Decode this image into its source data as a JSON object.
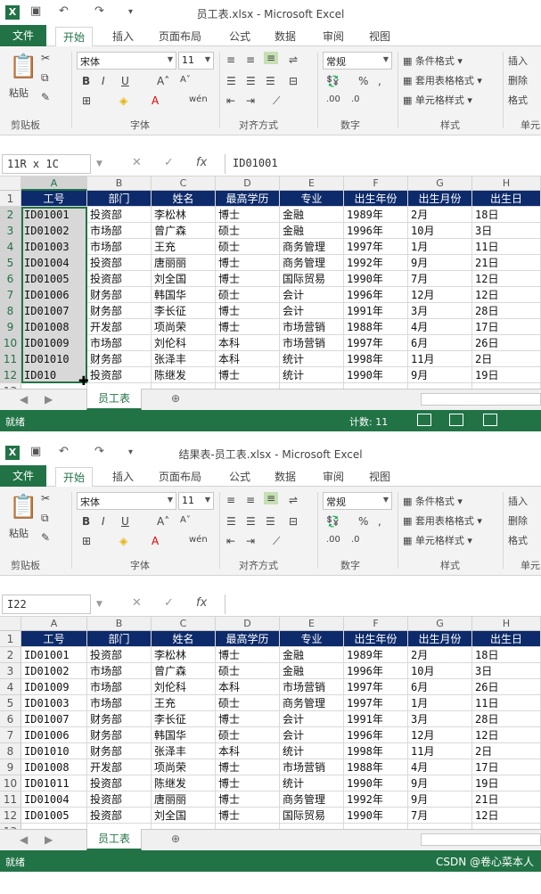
{
  "window1": {
    "title": "员工表.xlsx - Microsoft Excel",
    "namebox": "11R x 1C",
    "formula": "ID01001",
    "status": "就绪",
    "count": "计数: 11",
    "table": [
      [
        "工号",
        "部门",
        "姓名",
        "最高学历",
        "专业",
        "出生年份",
        "出生月份",
        "出生日"
      ],
      [
        "ID01001",
        "投资部",
        "李松林",
        "博士",
        "金融",
        "1989年",
        "2月",
        "18日"
      ],
      [
        "ID01002",
        "市场部",
        "曾广森",
        "硕士",
        "金融",
        "1996年",
        "10月",
        "3日"
      ],
      [
        "ID01003",
        "市场部",
        "王充",
        "硕士",
        "商务管理",
        "1997年",
        "1月",
        "11日"
      ],
      [
        "ID01004",
        "投资部",
        "唐丽丽",
        "博士",
        "商务管理",
        "1992年",
        "9月",
        "21日"
      ],
      [
        "ID01005",
        "投资部",
        "刘全国",
        "博士",
        "国际贸易",
        "1990年",
        "7月",
        "12日"
      ],
      [
        "ID01006",
        "财务部",
        "韩国华",
        "硕士",
        "会计",
        "1996年",
        "12月",
        "12日"
      ],
      [
        "ID01007",
        "财务部",
        "李长征",
        "博士",
        "会计",
        "1991年",
        "3月",
        "28日"
      ],
      [
        "ID01008",
        "开发部",
        "项尚荣",
        "博士",
        "市场营销",
        "1988年",
        "4月",
        "17日"
      ],
      [
        "ID01009",
        "市场部",
        "刘伦科",
        "本科",
        "市场营销",
        "1997年",
        "6月",
        "26日"
      ],
      [
        "ID01010",
        "财务部",
        "张泽丰",
        "本科",
        "统计",
        "1998年",
        "11月",
        "2日"
      ],
      [
        "ID010",
        "投资部",
        "陈继发",
        "博士",
        "统计",
        "1990年",
        "9月",
        "19日"
      ]
    ]
  },
  "window2": {
    "title": "结果表-员工表.xlsx - Microsoft Excel",
    "namebox": "I22",
    "formula": "",
    "status": "就绪",
    "table": [
      [
        "工号",
        "部门",
        "姓名",
        "最高学历",
        "专业",
        "出生年份",
        "出生月份",
        "出生日"
      ],
      [
        "ID01001",
        "投资部",
        "李松林",
        "博士",
        "金融",
        "1989年",
        "2月",
        "18日"
      ],
      [
        "ID01002",
        "市场部",
        "曾广森",
        "硕士",
        "金融",
        "1996年",
        "10月",
        "3日"
      ],
      [
        "ID01009",
        "市场部",
        "刘伦科",
        "本科",
        "市场营销",
        "1997年",
        "6月",
        "26日"
      ],
      [
        "ID01003",
        "市场部",
        "王充",
        "硕士",
        "商务管理",
        "1997年",
        "1月",
        "11日"
      ],
      [
        "ID01007",
        "财务部",
        "李长征",
        "博士",
        "会计",
        "1991年",
        "3月",
        "28日"
      ],
      [
        "ID01006",
        "财务部",
        "韩国华",
        "硕士",
        "会计",
        "1996年",
        "12月",
        "12日"
      ],
      [
        "ID01010",
        "财务部",
        "张泽丰",
        "本科",
        "统计",
        "1998年",
        "11月",
        "2日"
      ],
      [
        "ID01008",
        "开发部",
        "项尚荣",
        "博士",
        "市场营销",
        "1988年",
        "4月",
        "17日"
      ],
      [
        "ID01011",
        "投资部",
        "陈继发",
        "博士",
        "统计",
        "1990年",
        "9月",
        "19日"
      ],
      [
        "ID01004",
        "投资部",
        "唐丽丽",
        "博士",
        "商务管理",
        "1992年",
        "9月",
        "21日"
      ],
      [
        "ID01005",
        "投资部",
        "刘全国",
        "博士",
        "国际贸易",
        "1990年",
        "7月",
        "12日"
      ]
    ]
  },
  "ribbon": {
    "file_tab": "文件",
    "tabs": [
      "开始",
      "插入",
      "页面布局",
      "公式",
      "数据",
      "审阅",
      "视图"
    ],
    "font_name": "宋体",
    "font_size": "11",
    "number_format": "常规",
    "paste": "粘贴",
    "groups": [
      "剪贴板",
      "字体",
      "对齐方式",
      "数字",
      "样式",
      "单元"
    ],
    "styles": [
      "条件格式",
      "套用表格格式",
      "单元格样式"
    ],
    "cells_partial": [
      "插入",
      "删除",
      "格式"
    ]
  },
  "columns": [
    "A",
    "B",
    "C",
    "D",
    "E",
    "F",
    "G",
    "H"
  ],
  "rows": [
    "1",
    "2",
    "3",
    "4",
    "5",
    "6",
    "7",
    "8",
    "9",
    "10",
    "11",
    "12",
    "13"
  ],
  "sheet_tab": "员工表",
  "watermark": "CSDN @卷心菜本人",
  "colors": {
    "excel_green": "#217346",
    "header_navy": "#0d2b6b"
  }
}
